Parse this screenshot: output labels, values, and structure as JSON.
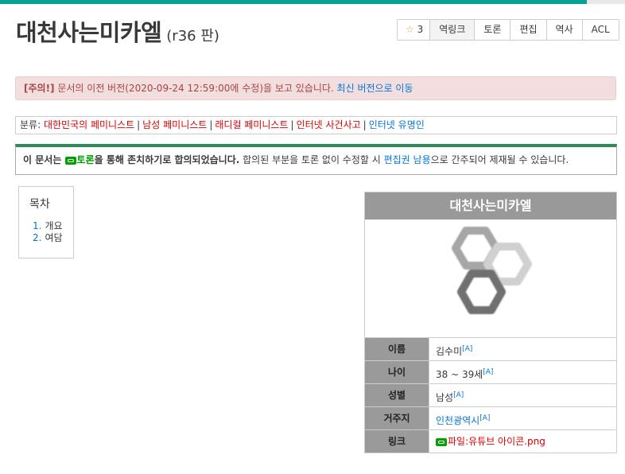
{
  "page": {
    "title": "대천사는미카엘",
    "revision": "(r36 판)"
  },
  "toolbar": {
    "star_count": "3",
    "backlinks": "역링크",
    "discuss": "토론",
    "edit": "편집",
    "history": "역사",
    "acl": "ACL"
  },
  "alert": {
    "prefix": "[주의!]",
    "message": " 문서의 이전 버전(2020-09-24 12:59:00에 수정)을 보고 있습니다. ",
    "link": "최신 버전으로 이동"
  },
  "categories": {
    "label": "분류: ",
    "items": [
      "대한민국의 페미니스트",
      "남성 페미니스트",
      "래디컬 페미니스트",
      "인터넷 사건사고",
      "인터넷 유명인"
    ]
  },
  "notice": {
    "bold1": "이 문서는 ",
    "link_discuss": "토론",
    "bold2": "을 통해 존치하기로 합의되었습니다.",
    "text1": " 합의된 부분을 토론 없이 수정할 시 ",
    "link_abuse": "편집권 남용",
    "text2": "으로 간주되어 제재될 수 있습니다."
  },
  "toc": {
    "title": "목차",
    "items": [
      {
        "num": "1.",
        "label": "개요"
      },
      {
        "num": "2.",
        "label": "여담"
      }
    ]
  },
  "infobox": {
    "header": "대천사는미카엘",
    "rows": [
      {
        "key": "이름",
        "value": "김수미",
        "ref": "[A]"
      },
      {
        "key": "나이",
        "value": "38 ~ 39세",
        "ref": "[A]"
      },
      {
        "key": "성별",
        "value": "남성",
        "ref": "[A]"
      },
      {
        "key": "거주지",
        "value": "인천광역시",
        "ref": "[A]"
      },
      {
        "key": "링크",
        "value": "파일:유튜브 아이콘.png",
        "ref": ""
      }
    ]
  },
  "colors": {
    "accent": "#00a495",
    "alert_bg": "#f2dede",
    "alert_text": "#a94442",
    "category_link": "#dd0000",
    "link_blue": "#0275d8",
    "infobox_header": "#999999"
  }
}
